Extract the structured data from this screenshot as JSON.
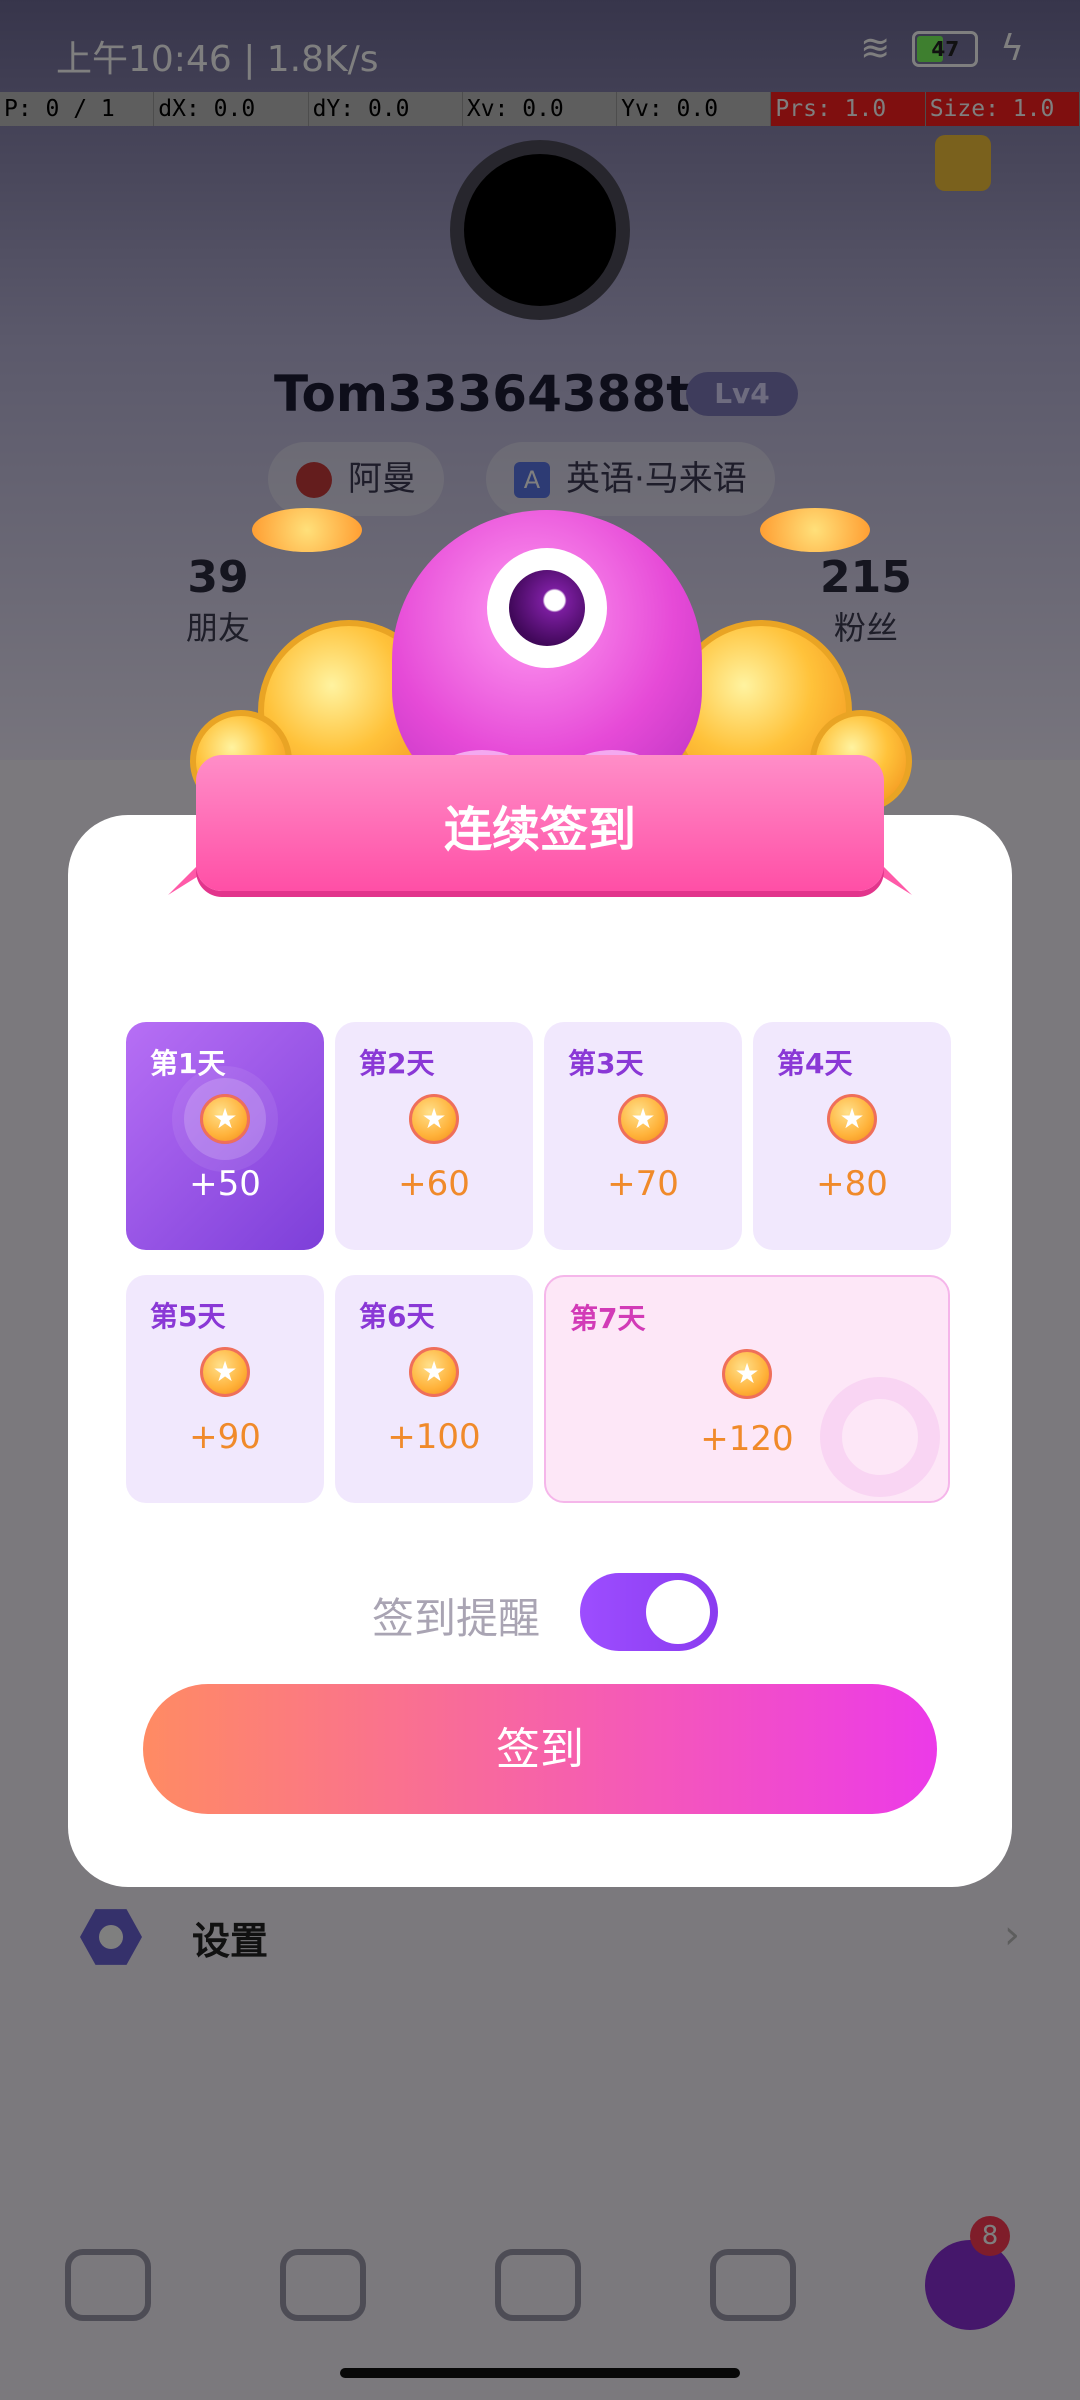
{
  "status_bar": {
    "time": "上午10:46 | 1.8K/s",
    "battery": "47"
  },
  "debug_bar": [
    "P: 0 / 1",
    "dX: 0.0",
    "dY: 0.0",
    "Xv: 0.0",
    "Yv: 0.0",
    "Prs: 1.0",
    "Size: 1.0"
  ],
  "profile": {
    "username": "Tom33364388ttt",
    "level": "Lv4",
    "country": "阿曼",
    "language_icon": "A",
    "languages": "英语·马来语",
    "friends_count": "39",
    "friends_label": "朋友",
    "fans_count": "215",
    "fans_label": "粉丝"
  },
  "settings_row": {
    "label": "设置",
    "arrow": "›"
  },
  "tab_badge": "8",
  "dialog": {
    "title": "连续签到",
    "days": [
      {
        "label": "第1天",
        "value": "+50"
      },
      {
        "label": "第2天",
        "value": "+60"
      },
      {
        "label": "第3天",
        "value": "+70"
      },
      {
        "label": "第4天",
        "value": "+80"
      },
      {
        "label": "第5天",
        "value": "+90"
      },
      {
        "label": "第6天",
        "value": "+100"
      },
      {
        "label": "第7天",
        "value": "+120"
      }
    ],
    "coin_glyph": "★",
    "reminder_label": "签到提醒",
    "reminder_on": true,
    "signin_button": "签到"
  }
}
